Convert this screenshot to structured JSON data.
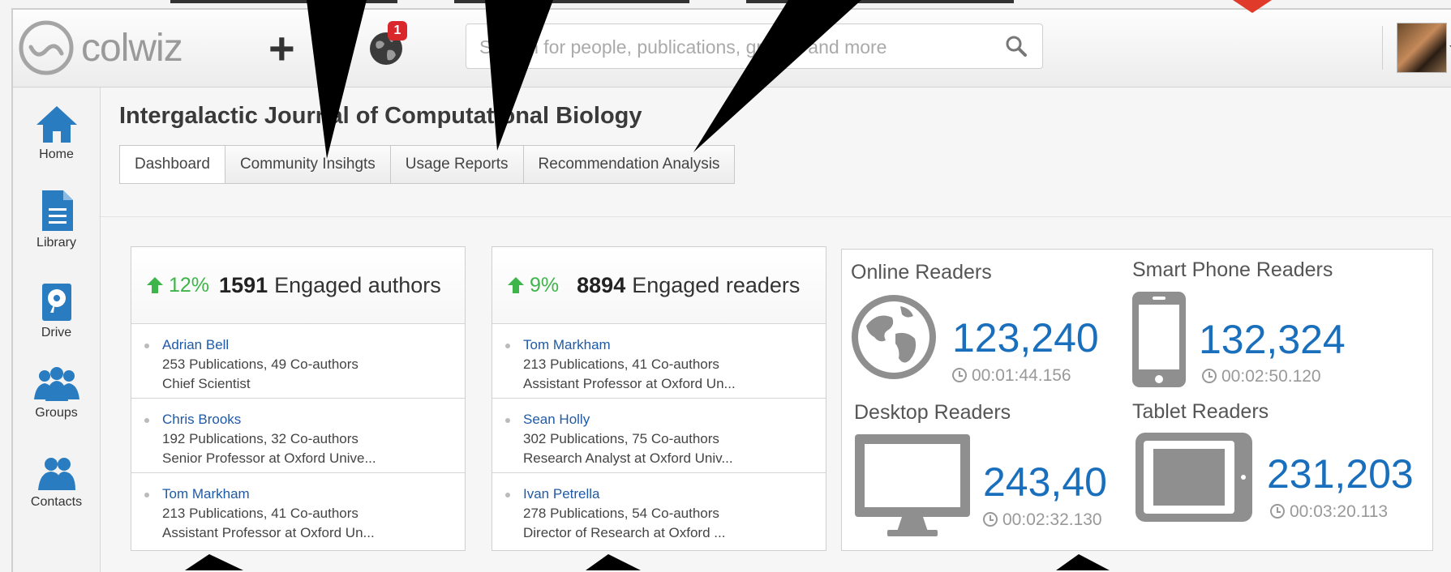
{
  "app": {
    "logo_text": "colwiz"
  },
  "header": {
    "notification_count": "1",
    "search_placeholder": "Search for people, publications, groups and more"
  },
  "sidebar": {
    "items": [
      {
        "label": "Home",
        "icon": "home-icon"
      },
      {
        "label": "Library",
        "icon": "library-icon"
      },
      {
        "label": "Drive",
        "icon": "drive-icon"
      },
      {
        "label": "Groups",
        "icon": "groups-icon"
      },
      {
        "label": "Contacts",
        "icon": "contacts-icon"
      }
    ]
  },
  "page": {
    "title": "Intergalactic Journal of Computational Biology",
    "tabs": [
      "Dashboard",
      "Community Insihgts",
      "Usage Reports",
      "Recommendation Analysis"
    ]
  },
  "authors_card": {
    "change": "12%",
    "count": "1591",
    "label": "Engaged authors",
    "people": [
      {
        "name": "Adrian Bell",
        "stats": "253 Publications, 49 Co-authors",
        "role": "Chief Scientist"
      },
      {
        "name": "Chris Brooks",
        "stats": "192 Publications, 32 Co-authors",
        "role": "Senior Professor at Oxford Unive..."
      },
      {
        "name": "Tom Markham",
        "stats": "213 Publications, 41 Co-authors",
        "role": "Assistant Professor at Oxford Un..."
      }
    ]
  },
  "readers_card": {
    "change": "9%",
    "count": "8894",
    "label": "Engaged readers",
    "people": [
      {
        "name": "Tom Markham",
        "stats": "213 Publications, 41 Co-authors",
        "role": "Assistant Professor at Oxford Un..."
      },
      {
        "name": "Sean Holly",
        "stats": "302 Publications, 75 Co-authors",
        "role": "Research Analyst at Oxford Univ..."
      },
      {
        "name": "Ivan Petrella",
        "stats": "278 Publications, 54 Co-authors",
        "role": "Director of Research at Oxford ..."
      }
    ]
  },
  "platforms": {
    "online": {
      "label": "Online Readers",
      "value": "123,240",
      "time": "00:01:44.156"
    },
    "phone": {
      "label": "Smart Phone Readers",
      "value": "132,324",
      "time": "00:02:50.120"
    },
    "desktop": {
      "label": "Desktop Readers",
      "value": "243,40",
      "time": "00:02:32.130"
    },
    "tablet": {
      "label": "Tablet Readers",
      "value": "231,203",
      "time": "00:03:20.113"
    }
  },
  "colors": {
    "accent": "#1a6fbd",
    "positive": "#3eb54a",
    "badge": "#d9282c",
    "annotation": "#000000",
    "marker": "#e03a2a"
  }
}
